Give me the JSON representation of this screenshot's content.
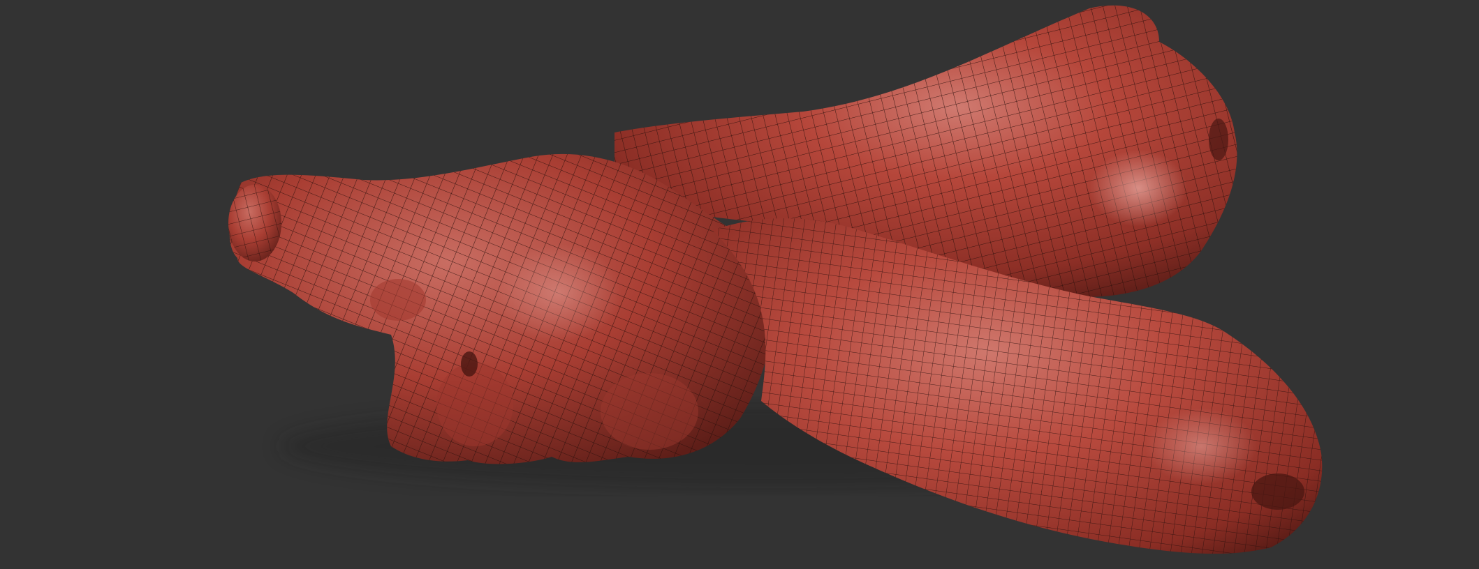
{
  "viewport": {
    "background_color": "#333333",
    "subject": "sculpted-mesh"
  },
  "model": {
    "material_color": "#b6473b",
    "highlight_color": "#d98a80",
    "shadow_color": "#5e1e18",
    "wire_color": "#2a0f0c",
    "display_mode": "polyframe"
  }
}
